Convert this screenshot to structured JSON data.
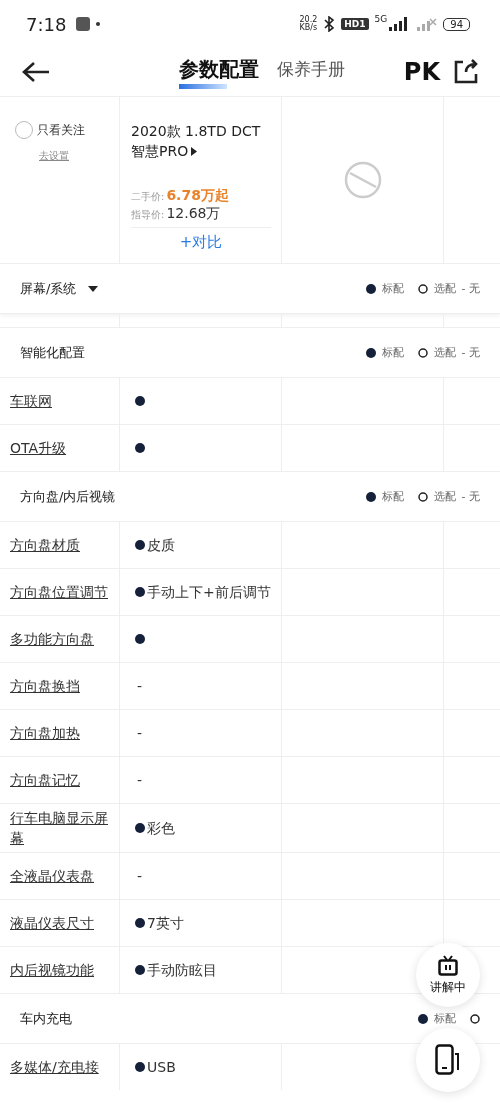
{
  "status_bar": {
    "time": "7:18",
    "speed": "20.2",
    "speed_unit": "KB/s",
    "hd": "HD1",
    "network": "5G",
    "battery": "94"
  },
  "nav": {
    "tabs": [
      {
        "label": "参数配置",
        "selected": true
      },
      {
        "label": "保养手册",
        "selected": false
      }
    ],
    "pk": "PK"
  },
  "header": {
    "follow_only": {
      "label": "只看关注",
      "checked": false
    },
    "settings_link": "去设置",
    "car": {
      "name": "2020款 1.8TD DCT 智慧PRO",
      "used_label": "二手价:",
      "used_price": "6.78万起",
      "guide_label": "指导价:",
      "guide_price": "12.68万",
      "compare": "+对比"
    }
  },
  "sections": [
    {
      "title": "屏幕/系统",
      "dropdown": true,
      "legend": [
        {
          "kind": "standard",
          "label": "标配"
        },
        {
          "kind": "optional",
          "label": "选配"
        },
        {
          "kind": "none",
          "label": "- 无"
        }
      ],
      "partial_row": true
    },
    {
      "title": "智能化配置",
      "dropdown": false,
      "legend": [
        {
          "kind": "standard",
          "label": "标配"
        },
        {
          "kind": "optional",
          "label": "选配"
        },
        {
          "kind": "none",
          "label": "- 无"
        }
      ],
      "rows": [
        {
          "name": "车联网",
          "value": {
            "kind": "standard"
          }
        },
        {
          "name": "OTA升级",
          "value": {
            "kind": "standard"
          }
        }
      ]
    },
    {
      "title": "方向盘/内后视镜",
      "dropdown": false,
      "legend": [
        {
          "kind": "standard",
          "label": "标配"
        },
        {
          "kind": "optional",
          "label": "选配"
        },
        {
          "kind": "none",
          "label": "- 无"
        }
      ],
      "rows": [
        {
          "name": "方向盘材质",
          "value": {
            "kind": "standard",
            "text": "皮质"
          }
        },
        {
          "name": "方向盘位置调节",
          "value": {
            "kind": "standard",
            "text": "手动上下+前后调节"
          }
        },
        {
          "name": "多功能方向盘",
          "value": {
            "kind": "standard"
          }
        },
        {
          "name": "方向盘换挡",
          "value": {
            "kind": "none",
            "text": "-"
          }
        },
        {
          "name": "方向盘加热",
          "value": {
            "kind": "none",
            "text": "-"
          }
        },
        {
          "name": "方向盘记忆",
          "value": {
            "kind": "none",
            "text": "-"
          }
        },
        {
          "name": "行车电脑显示屏幕",
          "value": {
            "kind": "standard",
            "text": "彩色"
          }
        },
        {
          "name": "全液晶仪表盘",
          "value": {
            "kind": "none",
            "text": "-"
          }
        },
        {
          "name": "液晶仪表尺寸",
          "value": {
            "kind": "standard",
            "text": "7英寸"
          }
        },
        {
          "name": "内后视镜功能",
          "value": {
            "kind": "standard",
            "text": "手动防眩目"
          }
        }
      ]
    },
    {
      "title": "车内充电",
      "dropdown": false,
      "legend": [
        {
          "kind": "standard",
          "label": "标配"
        },
        {
          "kind": "optional"
        }
      ],
      "rows": [
        {
          "name": "多媒体/充电接",
          "value": {
            "kind": "standard",
            "text": "USB"
          }
        }
      ]
    }
  ],
  "floating": {
    "explain": "讲解中"
  }
}
